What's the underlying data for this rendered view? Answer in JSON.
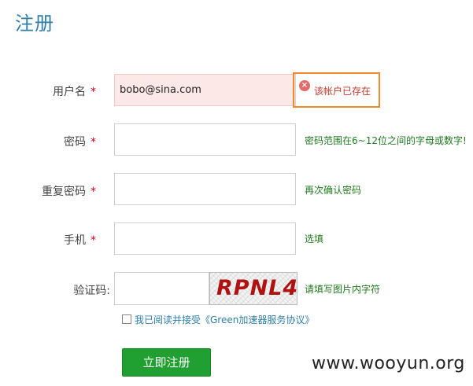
{
  "page": {
    "title": "注册"
  },
  "form": {
    "username": {
      "label": "用户名",
      "required_mark": "*",
      "value": "bobo@sina.com",
      "error_icon": "error-circle-icon",
      "error_icon_glyph": "×",
      "error": "该帐户已存在"
    },
    "password": {
      "label": "密码",
      "required_mark": "*",
      "value": "",
      "hint": "密码范围在6~12位之间的字母或数字!"
    },
    "repeat_password": {
      "label": "重复密码",
      "required_mark": "*",
      "value": "",
      "hint": "再次确认密码"
    },
    "phone": {
      "label": "手机",
      "required_mark": "*",
      "value": "",
      "hint": "选填"
    },
    "captcha": {
      "label": "验证码:",
      "value": "",
      "image_text": "RPNL4",
      "hint": "请填写图片内字符"
    },
    "agreement": {
      "checked": false,
      "text": "我已阅读并接受《Green加速器服务协议》"
    },
    "submit_label": "立即注册"
  },
  "watermark": "www.wooyun.org",
  "colors": {
    "title": "#2f7fa8",
    "required": "#d6001c",
    "error_border": "#ee8a2a",
    "error_text": "#c0392b",
    "hint_text": "#1f7a1f",
    "submit_bg": "#1fa030"
  }
}
